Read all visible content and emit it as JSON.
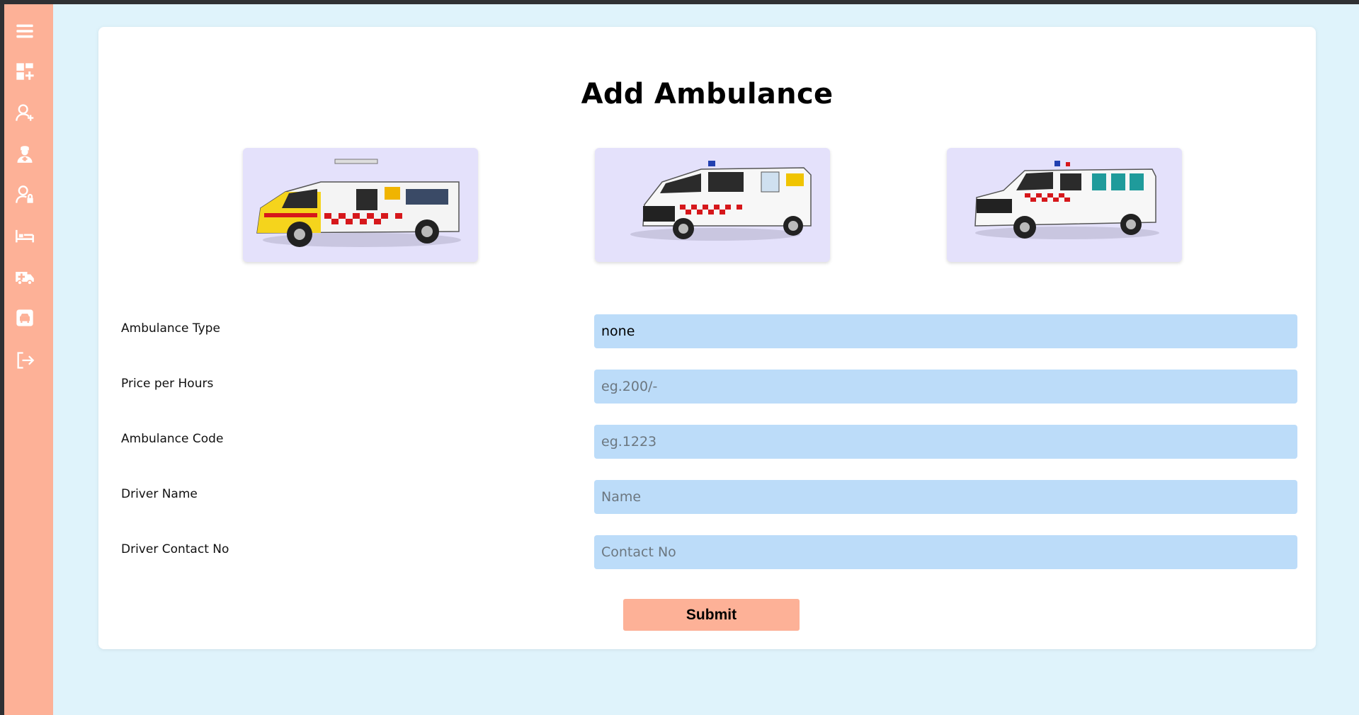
{
  "page": {
    "title": "Add Ambulance"
  },
  "sidebar": {
    "items": [
      {
        "icon": "menu-icon"
      },
      {
        "icon": "dashboard-add-icon"
      },
      {
        "icon": "add-user-icon"
      },
      {
        "icon": "doctor-icon"
      },
      {
        "icon": "user-lock-icon"
      },
      {
        "icon": "bed-icon"
      },
      {
        "icon": "ambulance-icon"
      },
      {
        "icon": "car-icon"
      },
      {
        "icon": "logout-icon"
      }
    ]
  },
  "vehicles": [
    {
      "name": "ambulance-van-image",
      "icon": "ambulance-van"
    },
    {
      "name": "ambulance-minivan-image",
      "icon": "ambulance-minivan"
    },
    {
      "name": "ambulance-suv-image",
      "icon": "ambulance-suv"
    }
  ],
  "form": {
    "ambulance_type": {
      "label": "Ambulance Type",
      "value": "none"
    },
    "price": {
      "label": "Price per Hours",
      "placeholder": "eg.200/-"
    },
    "code": {
      "label": "Ambulance Code",
      "placeholder": "eg.1223"
    },
    "driver_name": {
      "label": "Driver Name",
      "placeholder": "Name"
    },
    "driver_contact": {
      "label": "Driver Contact No",
      "placeholder": "Contact No"
    },
    "submit_label": "Submit"
  },
  "colors": {
    "sidebar": "#fdb197",
    "background": "#dff3fb",
    "input": "#bcdcf9",
    "submit": "#fdb197",
    "vehicle_card": "#e4e1fb"
  }
}
